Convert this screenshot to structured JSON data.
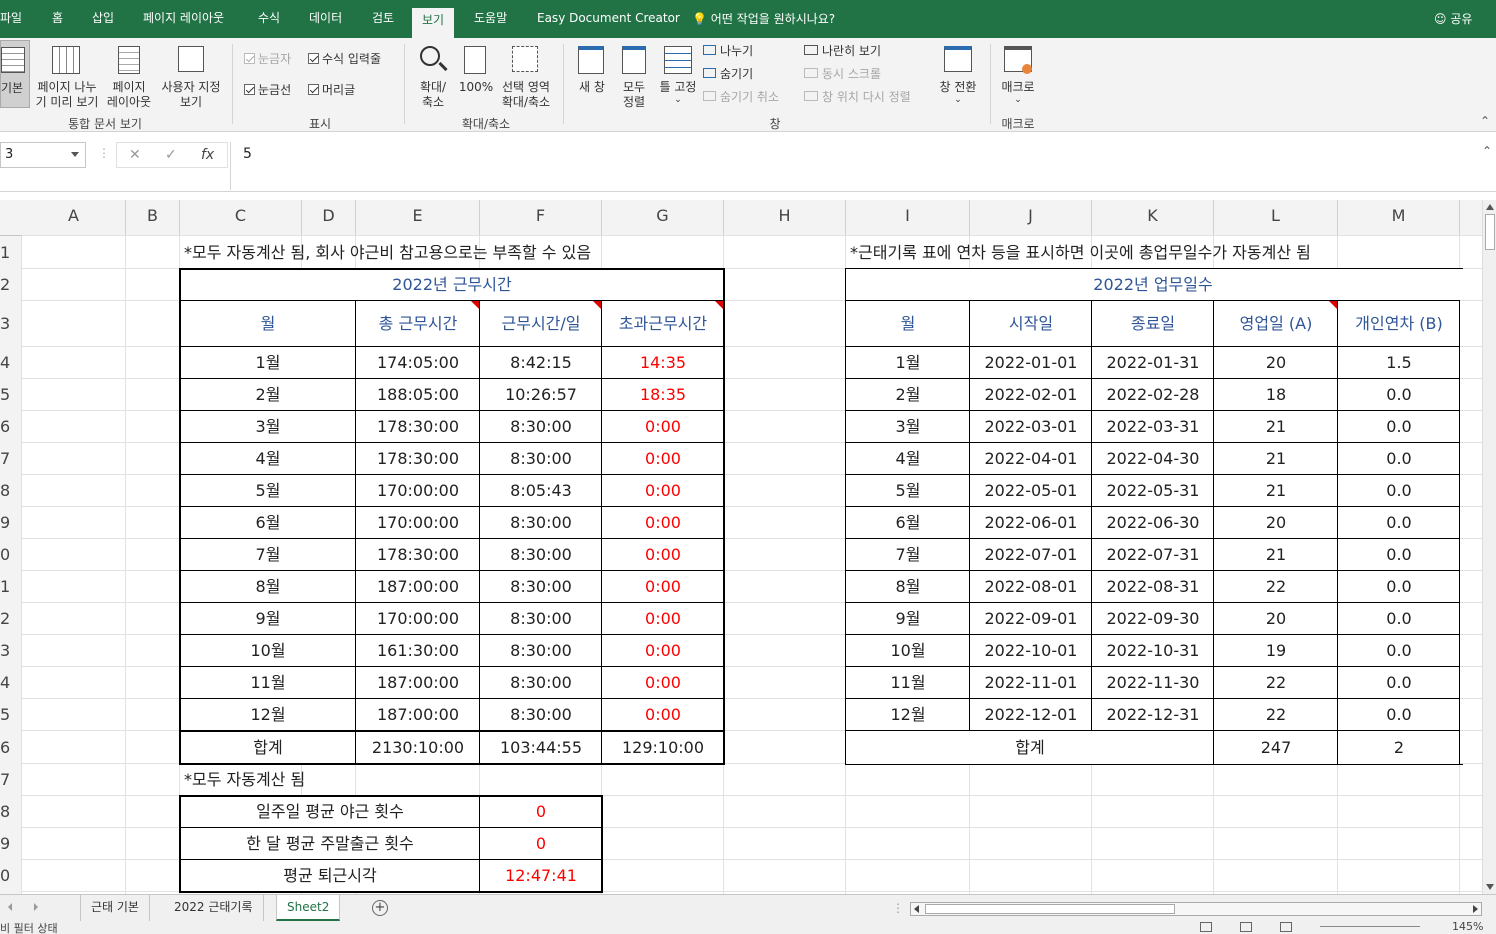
{
  "tabs": [
    "파일",
    "홈",
    "삽입",
    "페이지 레이아웃",
    "수식",
    "데이터",
    "검토",
    "보기",
    "도움말",
    "Easy Document Creator"
  ],
  "active_tab": "보기",
  "tell_me": "어떤 작업을 원하시나요?",
  "share": "공유",
  "ribbon": {
    "workbook_views": {
      "normal": "기본",
      "page_break_1": "페이지 나누",
      "page_break_2": "기 미리 보기",
      "page_layout_1": "페이지",
      "page_layout_2": "레이아웃",
      "custom_1": "사용자 지정",
      "custom_2": "보기",
      "group": "통합 문서 보기"
    },
    "show": {
      "ruler": "눈금자",
      "formula_bar": "수식 입력줄",
      "gridlines": "눈금선",
      "headings": "머리글",
      "group": "표시"
    },
    "zoom": {
      "zoom_1": "확대/",
      "zoom_2": "축소",
      "hundred": "100%",
      "selection_1": "선택 영역",
      "selection_2": "확대/축소",
      "group": "확대/축소"
    },
    "window": {
      "new_window": "새 창",
      "arrange_1": "모두",
      "arrange_2": "정렬",
      "freeze": "틀 고정",
      "split": "나누기",
      "hide": "숨기기",
      "unhide": "숨기기 취소",
      "side_by_side": "나란히 보기",
      "sync_scroll": "동시 스크롤",
      "reset_pos": "창 위치 다시 정렬",
      "switch": "창 전환",
      "group": "창"
    },
    "macros": {
      "macro": "매크로",
      "group": "매크로"
    }
  },
  "formula_bar": {
    "name_box": "3",
    "value": "5"
  },
  "columns": [
    "A",
    "B",
    "C",
    "D",
    "E",
    "F",
    "G",
    "H",
    "I",
    "J",
    "K",
    "L",
    "M"
  ],
  "rows": [
    "1",
    "2",
    "3",
    "4",
    "5",
    "6",
    "7",
    "8",
    "9",
    "0",
    "1",
    "2",
    "3",
    "4",
    "5",
    "6",
    "7",
    "8",
    "9",
    "0"
  ],
  "left_note": "*모두 자동계산 됨, 회사 야근비 참고용으로는 부족할 수 있음",
  "right_note": "*근태기록 표에 연차 등을 표시하면 이곳에 총업무일수가 자동계산 됨",
  "work_table": {
    "title": "2022년 근무시간",
    "headers": [
      "월",
      "총 근무시간",
      "근무시간/일",
      "초과근무시간"
    ],
    "rows": [
      [
        "1월",
        "174:05:00",
        "8:42:15",
        "14:35"
      ],
      [
        "2월",
        "188:05:00",
        "10:26:57",
        "18:35"
      ],
      [
        "3월",
        "178:30:00",
        "8:30:00",
        "0:00"
      ],
      [
        "4월",
        "178:30:00",
        "8:30:00",
        "0:00"
      ],
      [
        "5월",
        "170:00:00",
        "8:05:43",
        "0:00"
      ],
      [
        "6월",
        "170:00:00",
        "8:30:00",
        "0:00"
      ],
      [
        "7월",
        "178:30:00",
        "8:30:00",
        "0:00"
      ],
      [
        "8월",
        "187:00:00",
        "8:30:00",
        "0:00"
      ],
      [
        "9월",
        "170:00:00",
        "8:30:00",
        "0:00"
      ],
      [
        "10월",
        "161:30:00",
        "8:30:00",
        "0:00"
      ],
      [
        "11월",
        "187:00:00",
        "8:30:00",
        "0:00"
      ],
      [
        "12월",
        "187:00:00",
        "8:30:00",
        "0:00"
      ]
    ],
    "total": [
      "합계",
      "2130:10:00",
      "103:44:55",
      "129:10:00"
    ]
  },
  "auto_note": "*모두 자동계산 됨",
  "stats": [
    [
      "일주일 평균 야근 횟수",
      "0"
    ],
    [
      "한 달 평균 주말출근 횟수",
      "0"
    ],
    [
      "평균 퇴근시각",
      "12:47:41"
    ]
  ],
  "days_table": {
    "title": "2022년 업무일수",
    "headers": [
      "월",
      "시작일",
      "종료일",
      "영업일 (A)",
      "개인연차 (B)"
    ],
    "rows": [
      [
        "1월",
        "2022-01-01",
        "2022-01-31",
        "20",
        "1.5"
      ],
      [
        "2월",
        "2022-02-01",
        "2022-02-28",
        "18",
        "0.0"
      ],
      [
        "3월",
        "2022-03-01",
        "2022-03-31",
        "21",
        "0.0"
      ],
      [
        "4월",
        "2022-04-01",
        "2022-04-30",
        "21",
        "0.0"
      ],
      [
        "5월",
        "2022-05-01",
        "2022-05-31",
        "21",
        "0.0"
      ],
      [
        "6월",
        "2022-06-01",
        "2022-06-30",
        "20",
        "0.0"
      ],
      [
        "7월",
        "2022-07-01",
        "2022-07-31",
        "21",
        "0.0"
      ],
      [
        "8월",
        "2022-08-01",
        "2022-08-31",
        "22",
        "0.0"
      ],
      [
        "9월",
        "2022-09-01",
        "2022-09-30",
        "20",
        "0.0"
      ],
      [
        "10월",
        "2022-10-01",
        "2022-10-31",
        "19",
        "0.0"
      ],
      [
        "11월",
        "2022-11-01",
        "2022-11-30",
        "22",
        "0.0"
      ],
      [
        "12월",
        "2022-12-01",
        "2022-12-31",
        "22",
        "0.0"
      ]
    ],
    "total": [
      "합계",
      "247",
      "2"
    ]
  },
  "sheets": [
    "근태 기본",
    "2022 근태기록",
    "Sheet2"
  ],
  "active_sheet": "Sheet2",
  "status": {
    "left": "비  필터 상태",
    "zoom": "145%"
  },
  "colors": {
    "excel_green": "#217346",
    "header_blue": "#2f5597",
    "red_value": "#ff0000",
    "comment_marker": "#e00000"
  }
}
